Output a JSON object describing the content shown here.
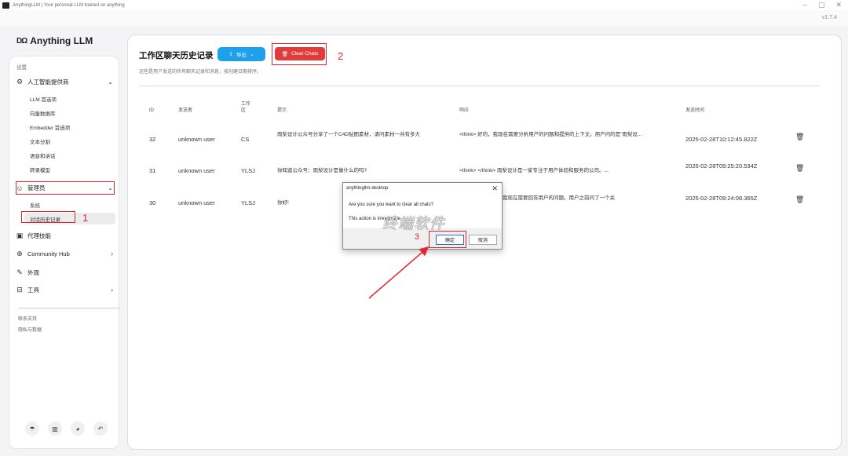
{
  "window": {
    "title": "AnythingLLM | Your personal LLM trained on anything",
    "controls": {
      "minimize": "–",
      "maximize": "▢",
      "close": "✕"
    },
    "version": "v1.7.4"
  },
  "logo": {
    "mark": "DΩ",
    "text": "Anything LLM"
  },
  "sidebar": {
    "settings_label": "设置",
    "ai_providers": {
      "label": "人工智能提供商",
      "items": [
        "LLM 首选项",
        "向量数据库",
        "Embedder 首选项",
        "文本分割",
        "语音和讲话",
        "转录模型"
      ]
    },
    "admin": {
      "label": "管理员",
      "items": [
        "系统",
        "对话历史记录"
      ]
    },
    "agent_skills": "代理技能",
    "community_hub": "Community Hub",
    "appearance": "外观",
    "tools": "工具",
    "contact_support": "联系支持",
    "privacy_data": "隐私与数据"
  },
  "main": {
    "title": "工作区聊天历史记录",
    "export_label": "导出",
    "clear_label": "Clear Chats",
    "subtitle": "这些是用户发送的所有聊天记录和消息，按创建日期排序。",
    "columns": [
      "ID",
      "发送者",
      "工作区",
      "提示",
      "响应",
      "发送时间"
    ],
    "rows": [
      {
        "id": "32",
        "sender": "unknown user",
        "workspace": "CS",
        "prompt": "雨梨设计公众号分享了一个C4D贴图素材，请问素材一共有多大",
        "response": "<think> 好的，我现在需要分析用户的问题和提供的上下文。用户问的是\"雨梨设...",
        "time": "2025-02-28T10:12:45.822Z"
      },
      {
        "id": "31",
        "sender": "unknown user",
        "workspace": "YLSJ",
        "prompt": "你知道公众号：雨梨设计是做什么的吗?",
        "response": "<think> </think> 雨梨设计是一家专注于用户体验和服务的公司。...",
        "time": "2025-02-28T09:25:20.534Z"
      },
      {
        "id": "30",
        "sender": "unknown user",
        "workspace": "YLSJ",
        "prompt": "你好!",
        "response": "我现在需要回答用户的问题。用户之前问了一个关",
        "time": "2025-02-28T09:24:08.365Z"
      }
    ]
  },
  "dialog": {
    "title": "anythingllm-desktop",
    "message": "Are you sure you want to clear all chats?",
    "warning": "This action is irreversible.",
    "confirm_label": "确定",
    "cancel_label": "取消"
  },
  "watermark": "终端软件",
  "annotations": [
    "1",
    "2",
    "3"
  ],
  "colors": {
    "export_button": "#1ea0ea",
    "clear_button": "#e03c3c",
    "annotation": "#e0282e"
  }
}
